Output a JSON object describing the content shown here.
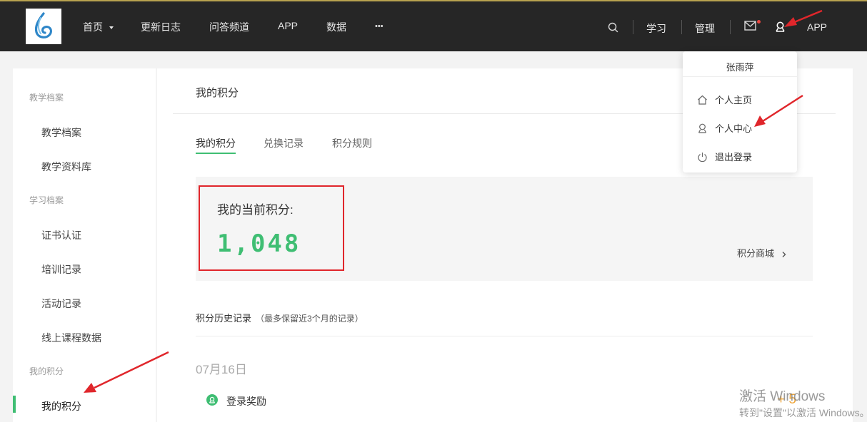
{
  "header": {
    "nav": [
      "首页",
      "更新日志",
      "问答频道",
      "APP",
      "数据",
      "•••"
    ],
    "right_items": {
      "learn": "学习",
      "manage": "管理",
      "app": "APP"
    },
    "icons": [
      "logo-icon",
      "chevron-down-icon",
      "search-icon",
      "mail-icon",
      "user-icon"
    ],
    "colors": {
      "background": "#262626",
      "accent_top": "#b8a24f",
      "notification_dot": "#e9463f"
    }
  },
  "user_menu": {
    "username": "张雨萍",
    "items": [
      {
        "label": "个人主页",
        "icon": "home-icon"
      },
      {
        "label": "个人中心",
        "icon": "user-icon"
      },
      {
        "label": "退出登录",
        "icon": "power-icon"
      }
    ]
  },
  "sidebar": {
    "groups": [
      {
        "title": "教学档案",
        "items": [
          "教学档案",
          "教学资料库"
        ]
      },
      {
        "title": "学习档案",
        "items": [
          "证书认证",
          "培训记录",
          "活动记录",
          "线上课程数据"
        ]
      },
      {
        "title": "我的积分",
        "items": [
          "我的积分"
        ]
      }
    ],
    "active_item": "我的积分"
  },
  "main": {
    "title": "我的积分",
    "tabs": [
      "我的积分",
      "兑换记录",
      "积分规则"
    ],
    "active_tab": "我的积分",
    "points_label": "我的当前积分:",
    "points_value": "1,048",
    "shop_link": "积分商城",
    "history_title": "积分历史记录",
    "history_note": "（最多保留近3个月的记录）",
    "records": [
      {
        "date": "07月16日",
        "label": "登录奖励",
        "points": "+ 5"
      }
    ],
    "colors": {
      "accent": "#3fbe73",
      "points": "#f0a63a",
      "annotation": "#e0262b"
    }
  },
  "watermark": {
    "line1": "激活 Windows",
    "line2": "转到\"设置\"以激活 Windows。"
  }
}
